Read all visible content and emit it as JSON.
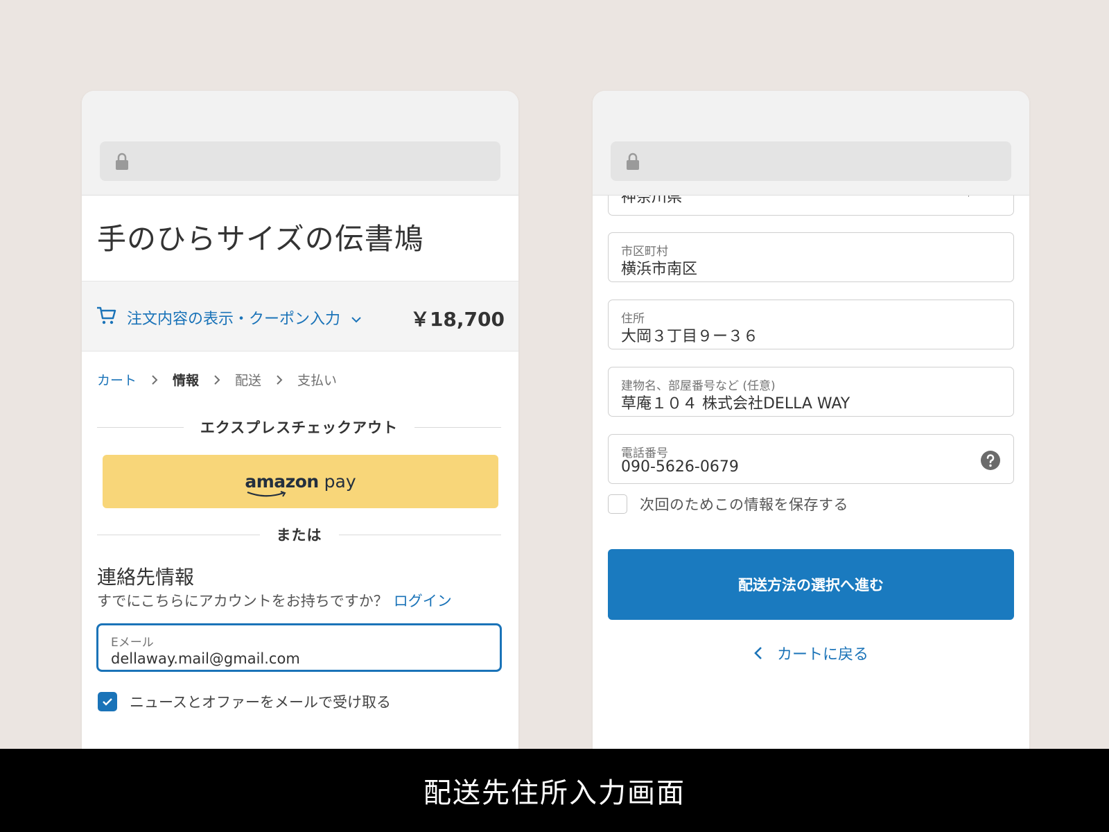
{
  "left_screen": {
    "store_title": "手のひらサイズの伝書鳩",
    "summary": {
      "toggle_label": "注文内容の表示・クーポン入力",
      "total": "￥18,700"
    },
    "breadcrumb": {
      "cart": "カート",
      "info": "情報",
      "shipping": "配送",
      "payment": "支払い"
    },
    "express_checkout_label": "エクスプレスチェックアウト",
    "amazon_pay": {
      "brand": "amazon",
      "suffix": " pay"
    },
    "or_label": "または",
    "contact": {
      "heading": "連絡先情報",
      "account_prompt": "すでにこちらにアカウントをお持ちですか？",
      "login_link": "ログイン",
      "email_label": "Eメール",
      "email_value": "dellaway.mail@gmail.com",
      "newsletter_label": "ニュースとオファーをメールで受け取る",
      "newsletter_checked": true
    }
  },
  "right_screen": {
    "prefecture_value": "神奈川県",
    "city": {
      "label": "市区町村",
      "value": "横浜市南区"
    },
    "address": {
      "label": "住所",
      "value": "大岡３丁目９ー３６"
    },
    "building": {
      "label": "建物名、部屋番号など (任意)",
      "value": "草庵１０４ 株式会社DELLA WAY"
    },
    "phone": {
      "label": "電話番号",
      "value": "090-5626-0679"
    },
    "save_info_label": "次回のためこの情報を保存する",
    "save_info_checked": false,
    "continue_button": "配送方法の選択へ進む",
    "back_link": "カートに戻る"
  },
  "caption": "配送先住所入力画面",
  "colors": {
    "accent": "#1a73b8",
    "button": "#1a7abf",
    "amazon": "#f8d679",
    "background": "#ebe5e1"
  }
}
